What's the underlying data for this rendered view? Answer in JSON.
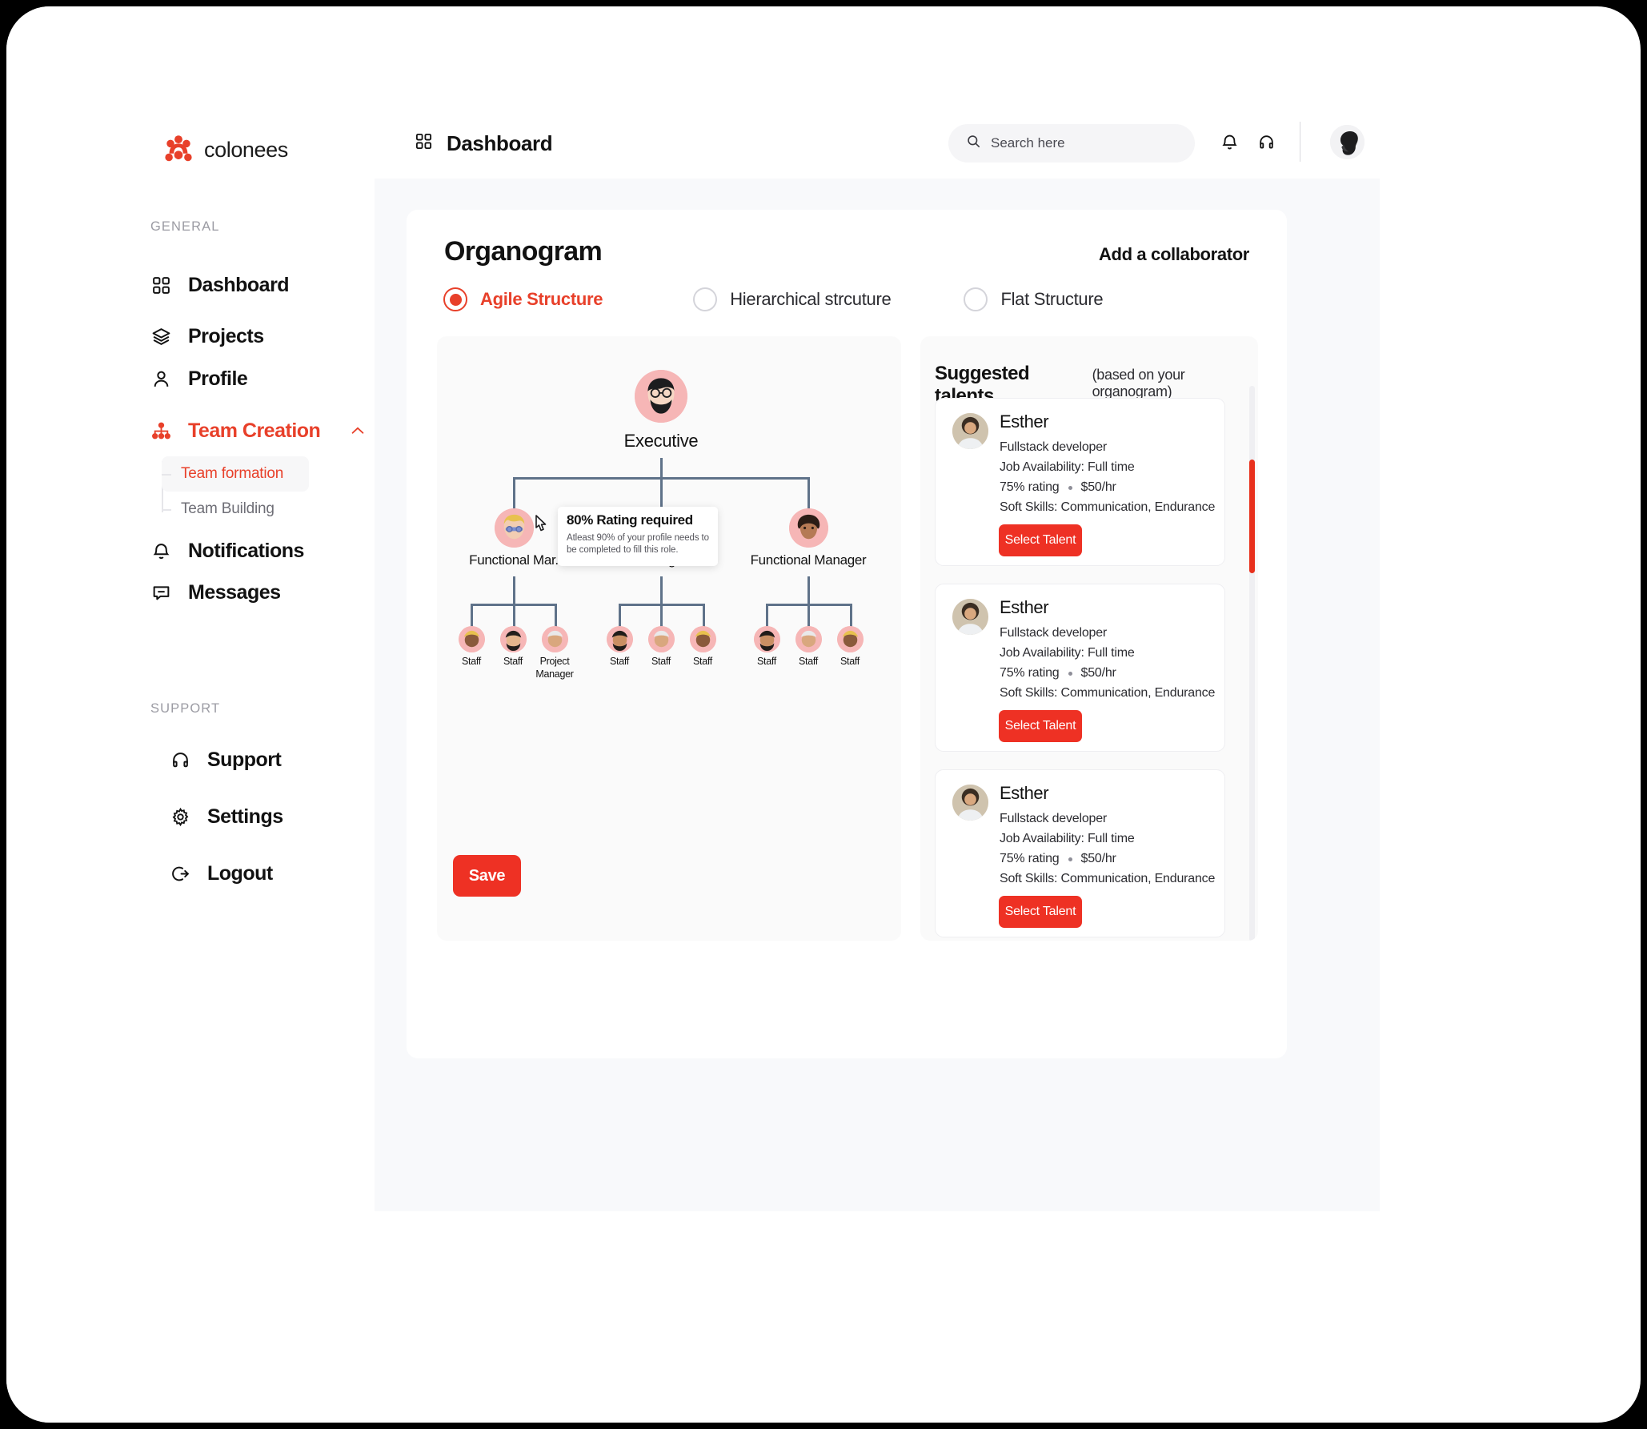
{
  "brand": {
    "name": "colonees",
    "accent": "#E8402A",
    "button_red": "#EE3124"
  },
  "sidebar": {
    "section_general": "GENERAL",
    "section_support": "SUPPORT",
    "items": [
      {
        "label": "Dashboard",
        "icon": "grid-icon"
      },
      {
        "label": "Projects",
        "icon": "layers-icon"
      },
      {
        "label": "Profile",
        "icon": "user-icon"
      },
      {
        "label": "Team Creation",
        "icon": "org-tree-icon"
      },
      {
        "label": "Notifications",
        "icon": "bell-icon"
      },
      {
        "label": "Messages",
        "icon": "message-icon"
      }
    ],
    "subitems": [
      {
        "label": "Team formation"
      },
      {
        "label": "Team Building"
      }
    ],
    "support_items": [
      {
        "label": "Support",
        "icon": "headset-icon"
      },
      {
        "label": "Settings",
        "icon": "gear-icon"
      },
      {
        "label": "Logout",
        "icon": "logout-icon"
      }
    ]
  },
  "topbar": {
    "title": "Dashboard",
    "search_placeholder": "Search here",
    "search_value": ""
  },
  "card": {
    "title": "Organogram",
    "add_collaborator": "Add a collaborator",
    "structure_options": [
      {
        "label": "Agile Structure",
        "selected": true
      },
      {
        "label": "Hierarchical strcuture",
        "selected": false
      },
      {
        "label": "Flat Structure",
        "selected": false
      }
    ],
    "save_label": "Save"
  },
  "tooltip": {
    "title": "80% Rating required",
    "body": "Atleast 90% of your profile needs to be completed to fill this role."
  },
  "organogram": {
    "executive": {
      "label": "Executive"
    },
    "managers": [
      {
        "label": "Functional Mar."
      },
      {
        "label": "Manager"
      },
      {
        "label": "Functional Manager"
      }
    ],
    "staff": [
      [
        "Staff",
        "Staff",
        "Project Manager"
      ],
      [
        "Staff",
        "Staff",
        "Staff"
      ],
      [
        "Staff",
        "Staff",
        "Staff"
      ]
    ]
  },
  "talents": {
    "heading": "Suggested talents",
    "subheading": "(based on your organogram)",
    "cards": [
      {
        "name": "Esther",
        "role": "Fullstack developer",
        "availability": "Job Availability: Full time",
        "rating": "75% rating",
        "rate": "$50/hr",
        "skills": "Soft Skills: Communication, Endurance",
        "button": "Select Talent"
      },
      {
        "name": "Esther",
        "role": "Fullstack developer",
        "availability": "Job Availability: Full time",
        "rating": "75% rating",
        "rate": "$50/hr",
        "skills": "Soft Skills: Communication, Endurance",
        "button": "Select Talent"
      },
      {
        "name": "Esther",
        "role": "Fullstack developer",
        "availability": "Job Availability: Full time",
        "rating": "75% rating",
        "rate": "$50/hr",
        "skills": "Soft Skills: Communication, Endurance",
        "button": "Select Talent"
      }
    ]
  }
}
